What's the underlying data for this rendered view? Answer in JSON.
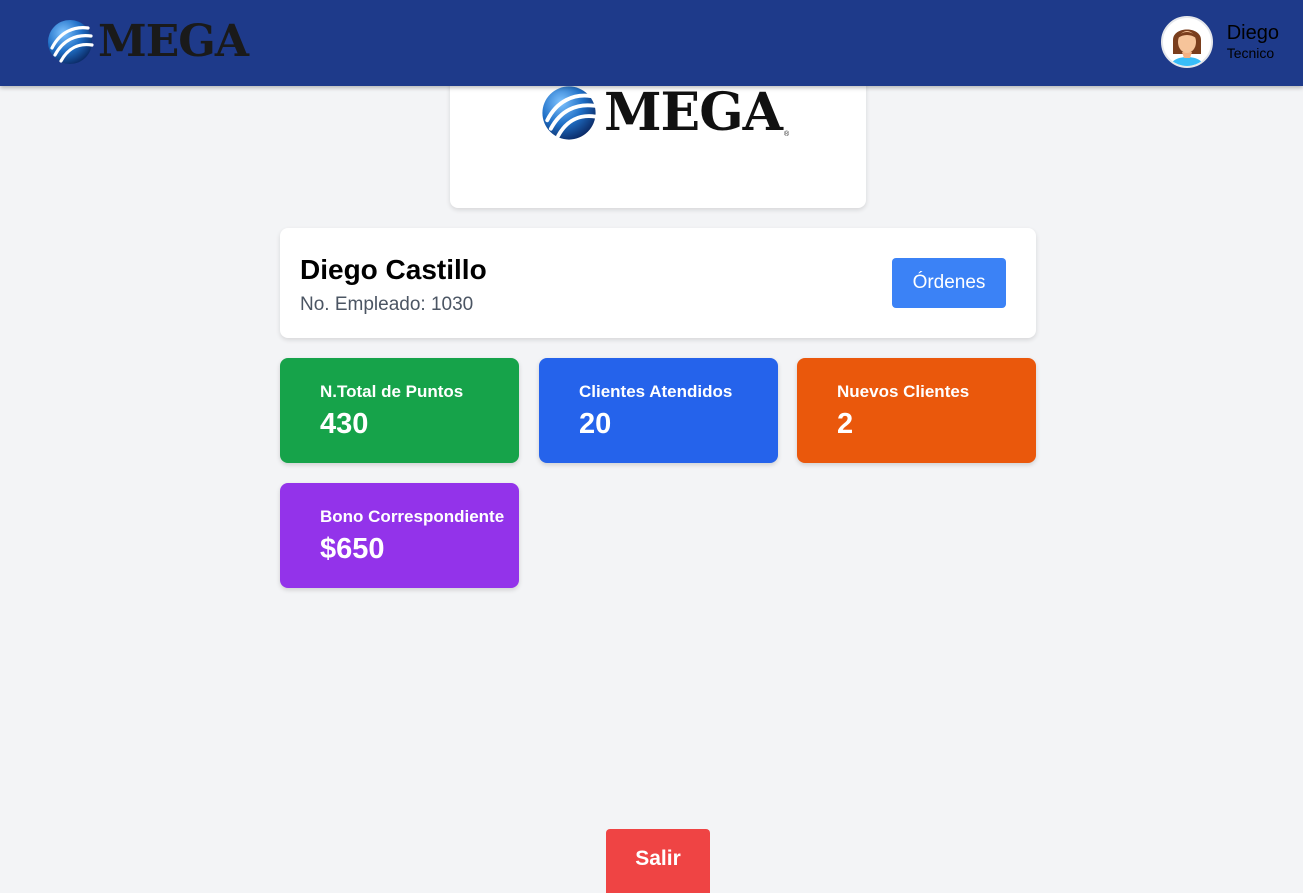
{
  "header": {
    "logo_text": "MEGA",
    "user_name": "Diego",
    "user_role": "Tecnico",
    "avatar_icon": "user-avatar-icon"
  },
  "hero": {
    "logo_text": "MEGA",
    "registered_mark": "®"
  },
  "profile": {
    "name": "Diego Castillo",
    "employee_label": "No. Empleado: 1030",
    "orders_button": "Órdenes"
  },
  "stats": [
    {
      "label": "N.Total de Puntos",
      "value": "430",
      "color": "#16a34a"
    },
    {
      "label": "Clientes Atendidos",
      "value": "20",
      "color": "#2563eb"
    },
    {
      "label": "Nuevos Clientes",
      "value": "2",
      "color": "#ea580c"
    },
    {
      "label": "Bono Correspondiente",
      "value": "$650",
      "color": "#9333ea"
    }
  ],
  "exit_button": {
    "label": "Salir",
    "color": "#ef4444"
  },
  "colors": {
    "topbar": "#1e3a8a",
    "background": "#f3f4f6",
    "primary_button": "#3b82f6"
  }
}
